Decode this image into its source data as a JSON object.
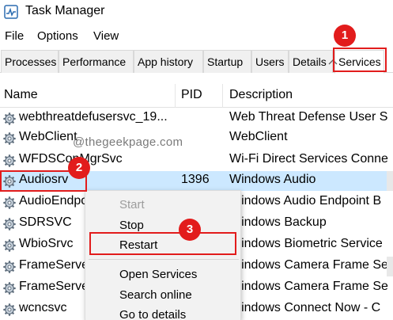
{
  "window": {
    "title": "Task Manager"
  },
  "menubar": [
    "File",
    "Options",
    "View"
  ],
  "tabs": [
    {
      "label": "Processes"
    },
    {
      "label": "Performance"
    },
    {
      "label": "App history"
    },
    {
      "label": "Startup"
    },
    {
      "label": "Users"
    },
    {
      "label": "Details"
    },
    {
      "label": "Services",
      "active": true
    }
  ],
  "columns": {
    "name": "Name",
    "pid": "PID",
    "description": "Description"
  },
  "rows": [
    {
      "name": "webthreatdefusersvc_19...",
      "pid": "",
      "description": "Web Threat Defense User S"
    },
    {
      "name": "WebClient",
      "pid": "",
      "description": "WebClient"
    },
    {
      "name": "WFDSConMgrSvc",
      "pid": "",
      "description": "Wi-Fi Direct Services Conne"
    },
    {
      "name": "Audiosrv",
      "pid": "1396",
      "description": "Windows Audio",
      "selected": true
    },
    {
      "name": "AudioEndpointBuilder",
      "pid": "",
      "description": "Windows Audio Endpoint B"
    },
    {
      "name": "SDRSVC",
      "pid": "",
      "description": "Windows Backup"
    },
    {
      "name": "WbioSrvc",
      "pid": "",
      "description": "Windows Biometric Service"
    },
    {
      "name": "FrameServer",
      "pid": "",
      "description": "Windows Camera Frame Se"
    },
    {
      "name": "FrameServerMonitor",
      "pid": "",
      "description": "Windows Camera Frame Se"
    },
    {
      "name": "wcncsvc",
      "pid": "",
      "description": "Windows Connect Now - C"
    }
  ],
  "context_menu": {
    "items": [
      {
        "label": "Start",
        "disabled": true
      },
      {
        "label": "Stop",
        "disabled": false
      },
      {
        "label": "Restart",
        "disabled": false
      },
      {
        "label": "Open Services",
        "disabled": false
      },
      {
        "label": "Search online",
        "disabled": false
      },
      {
        "label": "Go to details",
        "disabled": false
      }
    ]
  },
  "watermark": "@thegeekpage.com",
  "annotations": {
    "step1": "1",
    "step2": "2",
    "step3": "3"
  },
  "colors": {
    "annotation_red": "#e21c1c",
    "selection": "#cce8ff"
  },
  "icons": {
    "app": "task-manager-icon",
    "service": "gear-icon"
  }
}
